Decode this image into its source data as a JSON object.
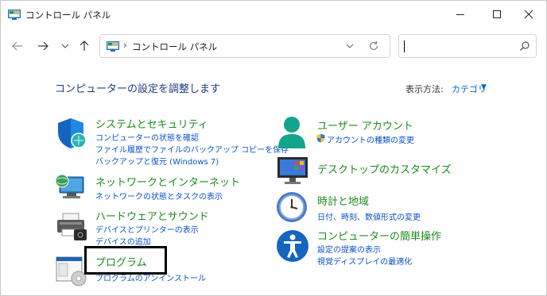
{
  "window": {
    "title": "コントロール パネル"
  },
  "address": {
    "separator": "›",
    "path": "コントロール パネル"
  },
  "search": {
    "value": "",
    "placeholder": ""
  },
  "main": {
    "heading": "コンピューターの設定を調整します",
    "view_label": "表示方法:",
    "view_value": "カテゴリ"
  },
  "categories": [
    {
      "title": "システムとセキュリティ",
      "links": [
        "コンピューターの状態を確認",
        "ファイル履歴でファイルのバックアップ コピーを保存",
        "バックアップと復元 (Windows 7)"
      ]
    },
    {
      "title": "ネットワークとインターネット",
      "links": [
        "ネットワークの状態とタスクの表示"
      ]
    },
    {
      "title": "ハードウェアとサウンド",
      "links": [
        "デバイスとプリンターの表示",
        "デバイスの追加"
      ]
    },
    {
      "title": "プログラム",
      "links": [
        "プログラムのアンインストール"
      ]
    },
    {
      "title": "ユーザー アカウント",
      "links": [
        "アカウントの種類の変更"
      ]
    },
    {
      "title": "デスクトップのカスタマイズ",
      "links": []
    },
    {
      "title": "時計と地域",
      "links": [
        "日付、時刻、数値形式の変更"
      ]
    },
    {
      "title": "コンピューターの簡単操作",
      "links": [
        "設定の提案の表示",
        "視覚ディスプレイの最適化"
      ]
    }
  ],
  "icons": {
    "app": "control-panel-icon",
    "security": "shield-icon",
    "network": "network-globe-icon",
    "hardware": "printer-icon",
    "programs": "programs-icon",
    "user": "user-icon",
    "uac": "uac-shield-icon",
    "desktop": "monitor-icon",
    "clock": "clock-icon",
    "ease": "accessibility-icon"
  },
  "colors": {
    "category_title": "#1b8a1b",
    "link": "#0b52c8",
    "heading": "#1e3c80",
    "highlight_border": "#000000"
  }
}
